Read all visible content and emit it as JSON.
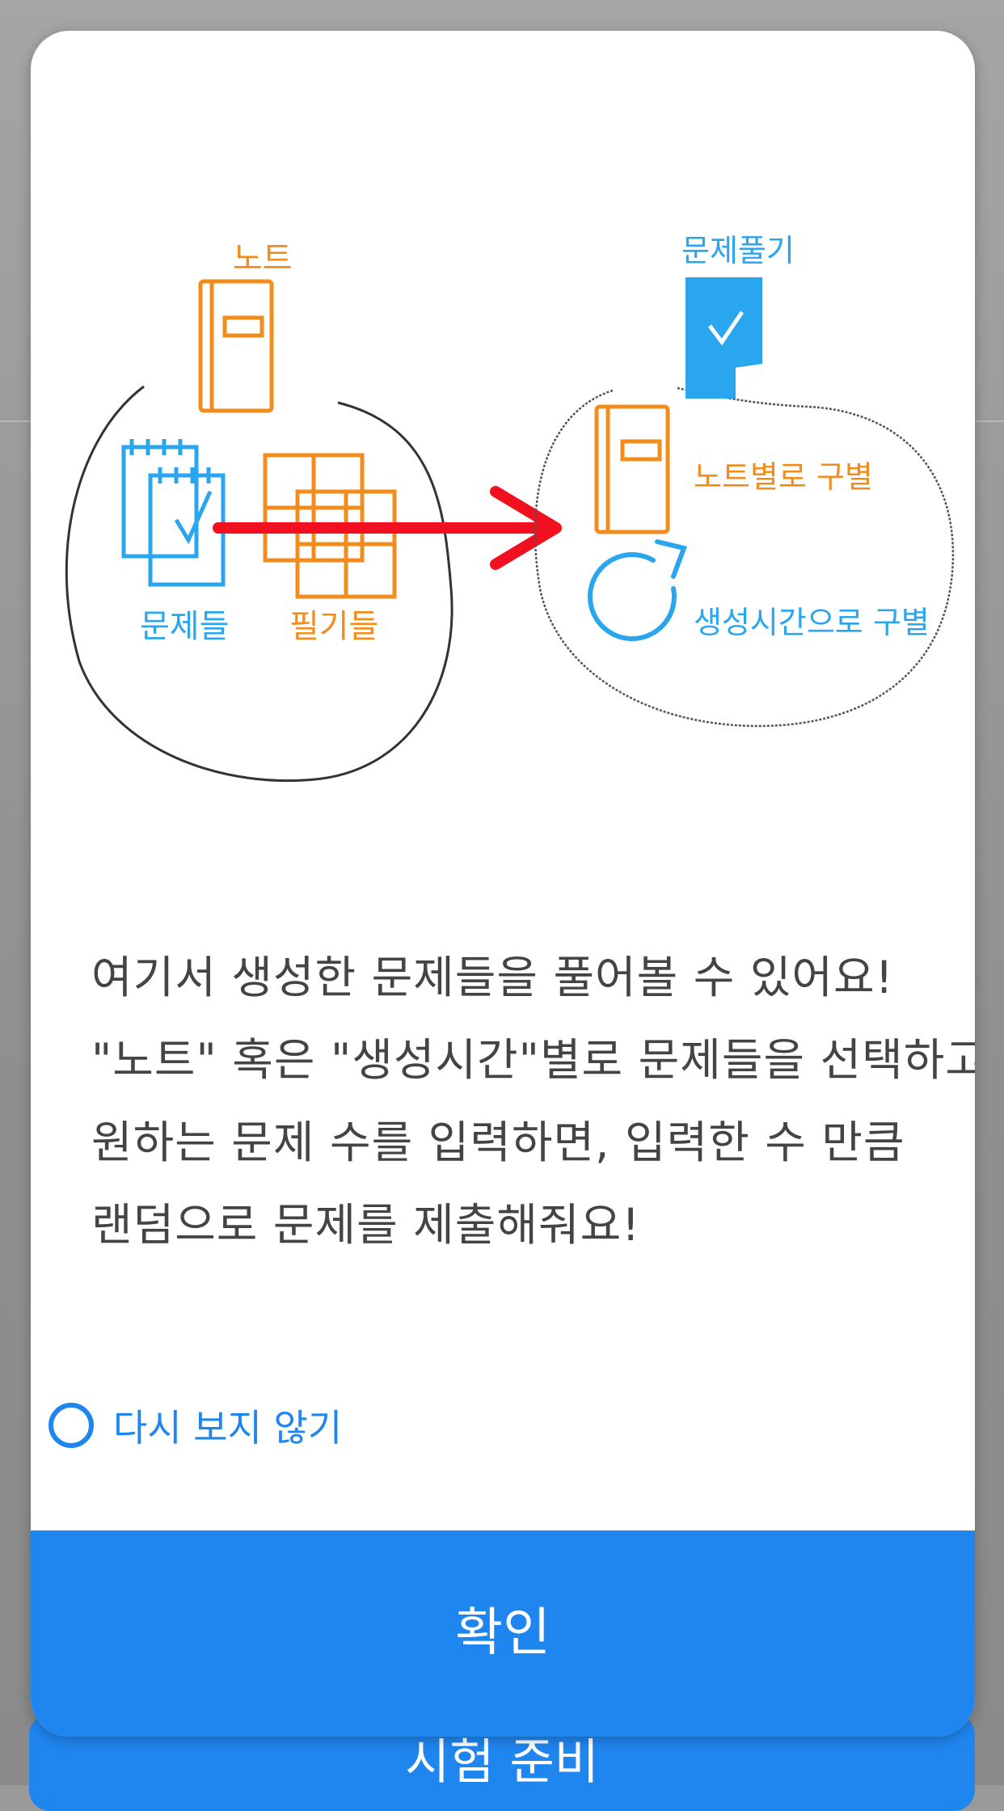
{
  "background": {
    "button_label": "시험 준비"
  },
  "dialog": {
    "illustration": {
      "left_group": {
        "note_label": "노트",
        "problems_label": "문제들",
        "notes_label": "필기들"
      },
      "right_group": {
        "solve_label": "문제풀기",
        "by_note_label": "노트별로 구별",
        "by_time_label": "생성시간으로 구별"
      }
    },
    "description_lines": [
      "여기서 생성한 문제들을 풀어볼 수 있어요!",
      "\"노트\" 혹은 \"생성시간\"별로 문제들을 선택하고,",
      "원하는 문제 수를 입력하면, 입력한 수 만큼",
      "랜덤으로 문제를 제출해줘요!"
    ],
    "dont_show_label": "다시 보지 않기",
    "confirm_label": "확인"
  },
  "colors": {
    "accent": "#1f86f0",
    "orange": "#f28c1c",
    "light_blue": "#2aa6ef",
    "red": "#f01020"
  }
}
